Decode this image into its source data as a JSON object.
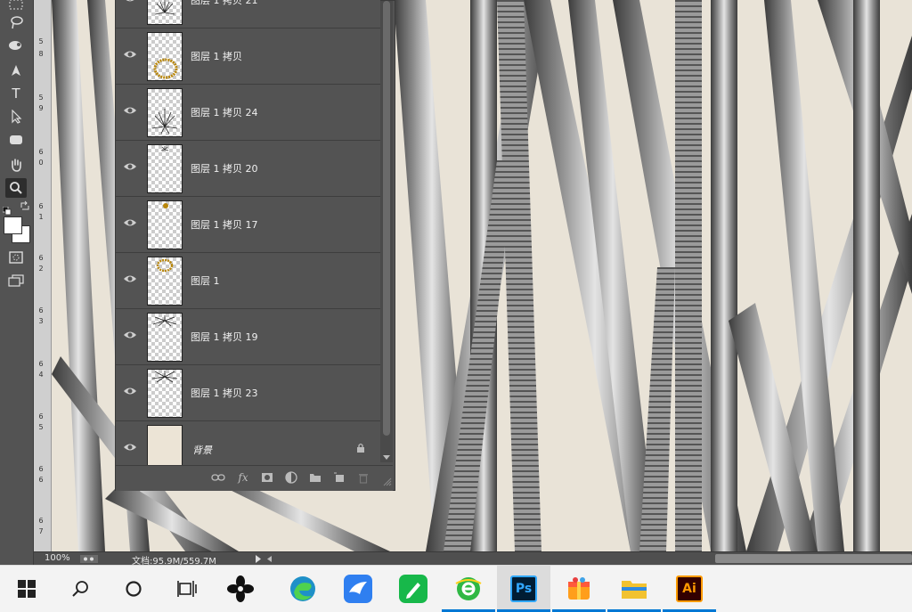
{
  "toolbar": {
    "tools": [
      "marquee",
      "lasso",
      "spot-healing",
      "pen",
      "type",
      "path-selection",
      "rectangle",
      "hand",
      "zoom",
      "default-colors",
      "swap-colors",
      "foreground-color",
      "background-color",
      "quick-mask",
      "screen-mode"
    ],
    "type_tool_glyph": "T",
    "active_tool": "zoom"
  },
  "ruler": {
    "labels": [
      "5",
      "8",
      "5",
      "9",
      "6",
      "0",
      "6",
      "1",
      "6",
      "2",
      "6",
      "3",
      "6",
      "4",
      "6",
      "5",
      "6",
      "6",
      "6",
      "7"
    ]
  },
  "layers": [
    {
      "name": "图层 1 拷贝 21",
      "visible": true,
      "thumbnail": "dark-splatter"
    },
    {
      "name": "图层 1 拷贝",
      "visible": true,
      "thumbnail": "gold-ring"
    },
    {
      "name": "图层 1 拷贝 24",
      "visible": true,
      "thumbnail": "dark-splatter"
    },
    {
      "name": "图层 1 拷贝 20",
      "visible": true,
      "thumbnail": "small-dot"
    },
    {
      "name": "图层 1 拷贝 17",
      "visible": true,
      "thumbnail": "gold-dot"
    },
    {
      "name": "图层 1",
      "visible": true,
      "thumbnail": "gold-ring"
    },
    {
      "name": "图层 1 拷贝 19",
      "visible": true,
      "thumbnail": "dark-splatter"
    },
    {
      "name": "图层 1 拷贝 23",
      "visible": true,
      "thumbnail": "dark-splatter"
    },
    {
      "name": "背景",
      "visible": true,
      "thumbnail": "cream-fill",
      "locked": true
    }
  ],
  "panel_footer": {
    "icons": [
      "link-icon",
      "fx-icon",
      "mask-icon",
      "adjustment-icon",
      "group-folder-icon",
      "new-layer-icon",
      "delete-icon"
    ],
    "fx_label": "fx"
  },
  "status": {
    "zoom": "100%",
    "doc_info": "文档:95.9M/559.7M"
  },
  "taskbar": {
    "items": [
      {
        "name": "start",
        "label": ""
      },
      {
        "name": "search",
        "label": ""
      },
      {
        "name": "cortana",
        "label": ""
      },
      {
        "name": "task-view",
        "label": ""
      },
      {
        "name": "app-flower",
        "label": ""
      },
      {
        "name": "edge",
        "label": ""
      },
      {
        "name": "bird-app",
        "label": ""
      },
      {
        "name": "green-app",
        "label": ""
      },
      {
        "name": "ie-green",
        "label": "",
        "active": true
      },
      {
        "name": "photoshop",
        "label": "Ps",
        "active": true
      },
      {
        "name": "gift-app",
        "label": "",
        "active": true
      },
      {
        "name": "file-explorer",
        "label": "",
        "active": true
      },
      {
        "name": "illustrator",
        "label": "Ai",
        "active": true
      }
    ]
  },
  "colors": {
    "panel": "#535353",
    "canvas_bg": "#e9e3d7",
    "accent": "#0078d4",
    "ps_blue": "#31a8ff",
    "ai_orange": "#ff9a00"
  }
}
